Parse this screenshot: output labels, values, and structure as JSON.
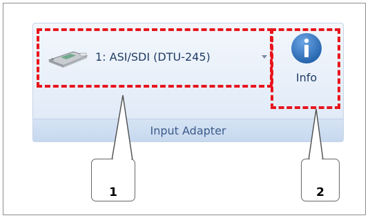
{
  "ribbon": {
    "adapter_selector": {
      "value": "1: ASI/SDI (DTU-245)",
      "device_icon": "usb-adapter-device-icon",
      "dropdown_icon": "chevron-down-icon"
    },
    "info_button": {
      "label": "Info",
      "icon": "info-circle-icon"
    },
    "group_label": "Input Adapter"
  },
  "annotations": {
    "callouts": [
      {
        "number": "1",
        "target": "adapter-selector"
      },
      {
        "number": "2",
        "target": "info-button"
      }
    ],
    "highlight_color": "#e8141c"
  },
  "colors": {
    "ribbon_background": "#e6eef9",
    "group_label_text": "#3b5a8a",
    "info_icon_fill": "#2f6fba"
  }
}
